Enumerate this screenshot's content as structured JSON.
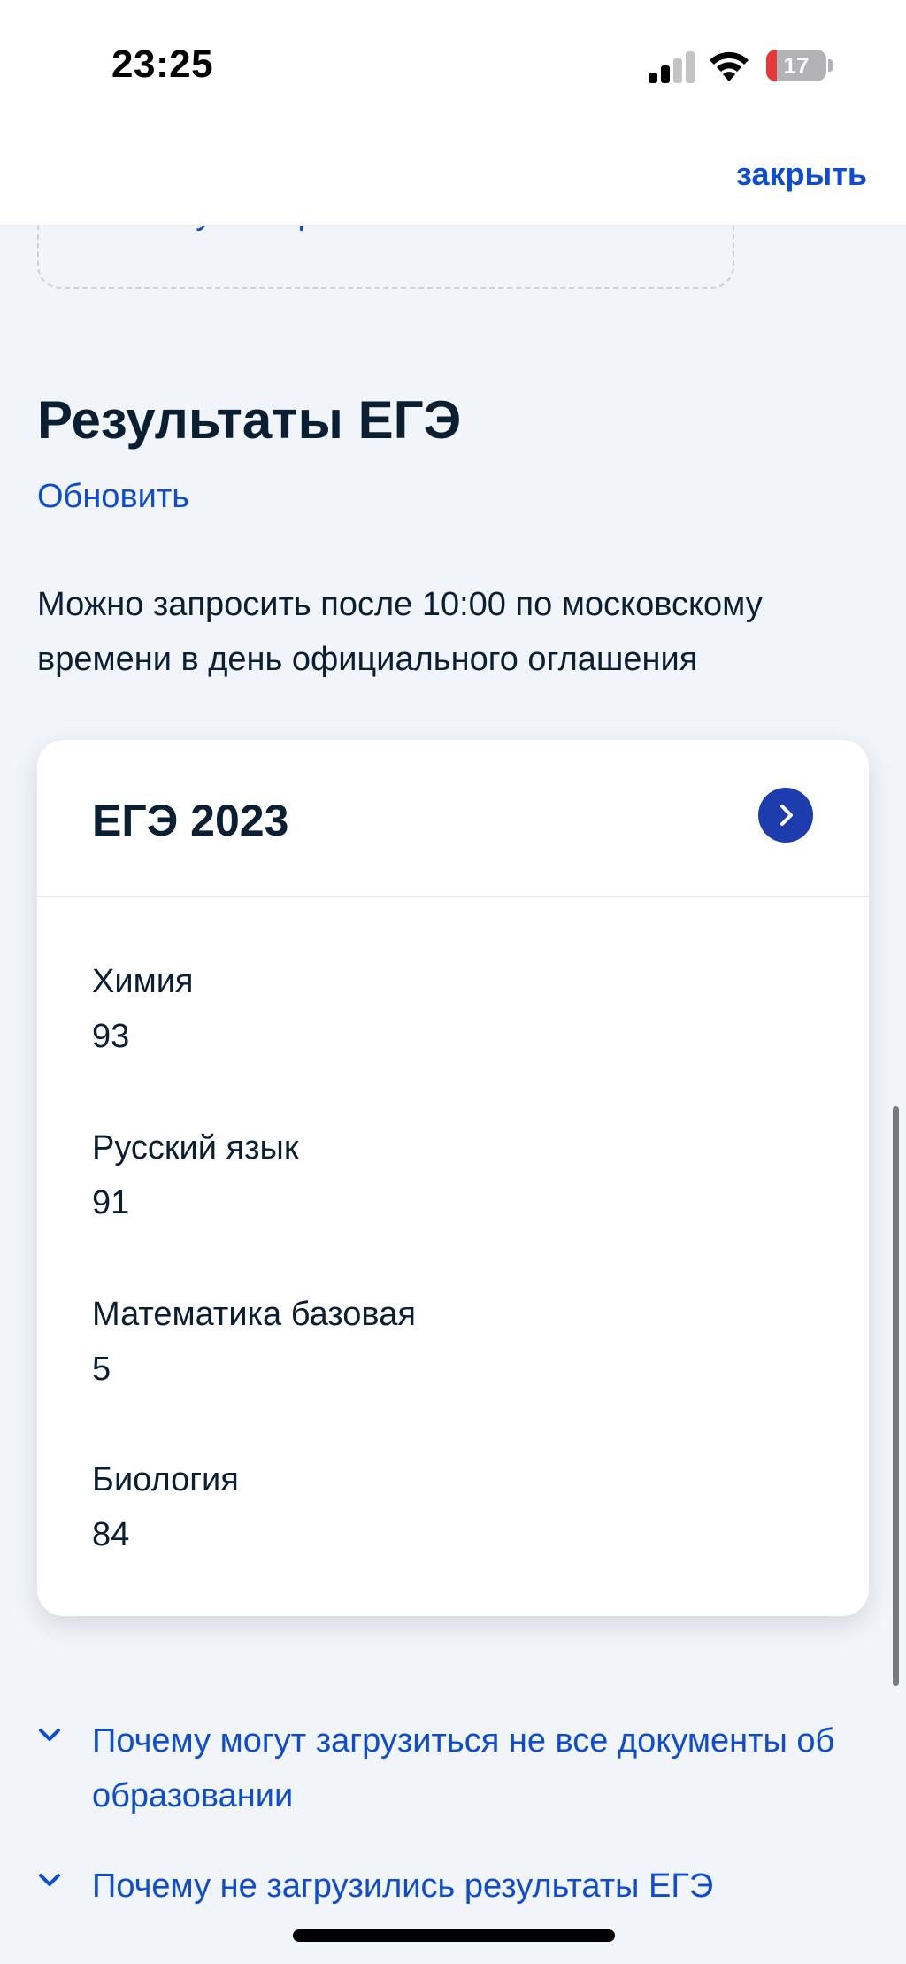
{
  "status_bar": {
    "time": "23:25",
    "battery_percent": "17",
    "battery_level": 0.17,
    "signal_bars_active": 2,
    "signal_bars_total": 4
  },
  "top_bar": {
    "close_label": "закрыть"
  },
  "clipped_card": {
    "partial_text": "Почему так произошло"
  },
  "section": {
    "title": "Результаты ЕГЭ",
    "refresh_label": "Обновить",
    "info_text": "Можно запросить после 10:00 по московскому времени в день официального оглашения"
  },
  "exam_card": {
    "title": "ЕГЭ 2023",
    "subjects": [
      {
        "name": "Химия",
        "score": "93"
      },
      {
        "name": "Русский язык",
        "score": "91"
      },
      {
        "name": "Математика базовая",
        "score": "5"
      },
      {
        "name": "Биология",
        "score": "84"
      }
    ]
  },
  "faq": [
    {
      "label": "Почему могут загрузиться не все документы об образовании"
    },
    {
      "label": "Почему не загрузились результаты ЕГЭ"
    }
  ],
  "colors": {
    "accent": "#0d4cd3",
    "button": "#1d3cae",
    "background": "#f1f4f9",
    "text": "#0b1f33"
  },
  "icons": {
    "card_action": "chevron-right-icon",
    "faq_toggle": "chevron-down-icon"
  }
}
